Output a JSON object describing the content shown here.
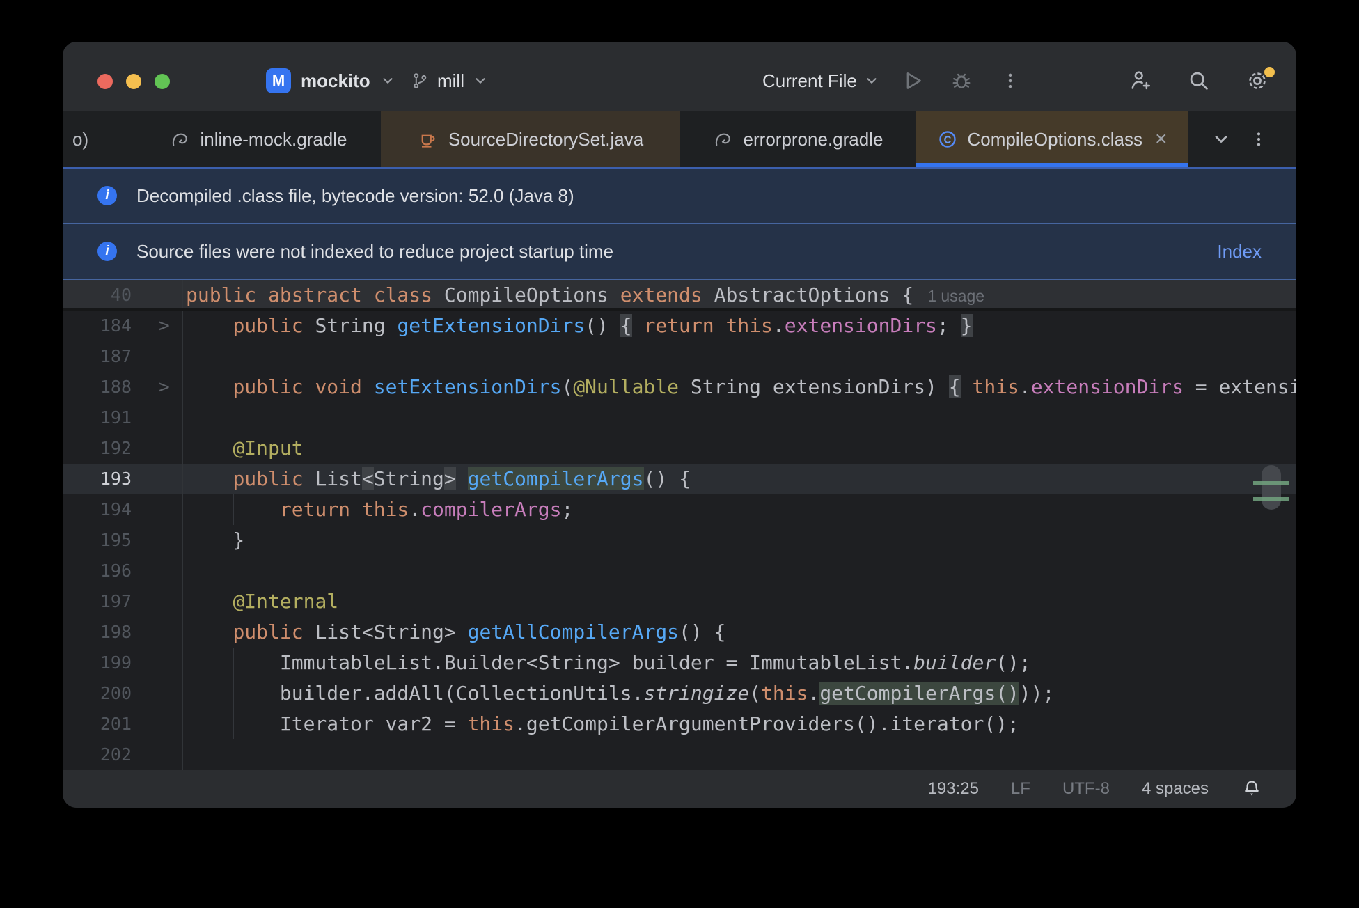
{
  "window": {
    "project": "mockito",
    "branch": "mill",
    "run_config": "Current File"
  },
  "tabs": {
    "items": [
      {
        "label": "o)"
      },
      {
        "label": "inline-mock.gradle",
        "icon": "gradle-icon"
      },
      {
        "label": "SourceDirectorySet.java",
        "icon": "java-icon"
      },
      {
        "label": "errorprone.gradle",
        "icon": "gradle-icon"
      },
      {
        "label": "CompileOptions.class",
        "icon": "class-icon",
        "active": true,
        "close": "×"
      }
    ]
  },
  "banners": [
    {
      "text": "Decompiled .class file, bytecode version: 52.0 (Java 8)"
    },
    {
      "text": "Source files were not indexed to reduce project startup time",
      "action": "Index"
    }
  ],
  "sticky": {
    "line_number": "40",
    "usage": "1 usage",
    "seg": [
      [
        "k",
        "public abstract class "
      ],
      [
        "p",
        "CompileOptions "
      ],
      [
        "k",
        "extends "
      ],
      [
        "p",
        "AbstractOptions {"
      ]
    ]
  },
  "editor": {
    "lines": [
      {
        "n": "184",
        "fold": true,
        "seg": [
          [
            "p",
            "    "
          ],
          [
            "k",
            "public"
          ],
          [
            "p",
            " String "
          ],
          [
            "m",
            "getExtensionDirs"
          ],
          [
            "p",
            "() "
          ],
          [
            "pb",
            "{"
          ],
          [
            "p",
            " "
          ],
          [
            "k",
            "return this"
          ],
          [
            "p",
            "."
          ],
          [
            "f",
            "extensionDirs"
          ],
          [
            "p",
            "; "
          ],
          [
            "pb",
            "}"
          ]
        ]
      },
      {
        "n": "187",
        "seg": []
      },
      {
        "n": "188",
        "fold": true,
        "seg": [
          [
            "p",
            "    "
          ],
          [
            "k",
            "public void "
          ],
          [
            "m",
            "setExtensionDirs"
          ],
          [
            "p",
            "("
          ],
          [
            "a",
            "@Nullable"
          ],
          [
            "p",
            " String extensionDirs) "
          ],
          [
            "pb",
            "{"
          ],
          [
            "p",
            " "
          ],
          [
            "k",
            "this"
          ],
          [
            "p",
            "."
          ],
          [
            "f",
            "extensionDirs"
          ],
          [
            "p",
            " = extensionDirs"
          ]
        ]
      },
      {
        "n": "191",
        "seg": []
      },
      {
        "n": "192",
        "seg": [
          [
            "p",
            "    "
          ],
          [
            "a",
            "@Input"
          ]
        ]
      },
      {
        "n": "193",
        "current": true,
        "seg": [
          [
            "p",
            "    "
          ],
          [
            "k",
            "public"
          ],
          [
            "p",
            " List"
          ],
          [
            "pb",
            "<"
          ],
          [
            "p",
            "String"
          ],
          [
            "pb",
            ">"
          ],
          [
            "p",
            " "
          ],
          [
            "mh",
            "getCompilerArgs"
          ],
          [
            "p",
            "() {"
          ]
        ]
      },
      {
        "n": "194",
        "guide": true,
        "seg": [
          [
            "p",
            "        "
          ],
          [
            "k",
            "return this"
          ],
          [
            "p",
            "."
          ],
          [
            "f",
            "compilerArgs"
          ],
          [
            "p",
            ";"
          ]
        ]
      },
      {
        "n": "195",
        "seg": [
          [
            "p",
            "    }"
          ]
        ]
      },
      {
        "n": "196",
        "seg": []
      },
      {
        "n": "197",
        "seg": [
          [
            "p",
            "    "
          ],
          [
            "a",
            "@Internal"
          ]
        ]
      },
      {
        "n": "198",
        "seg": [
          [
            "p",
            "    "
          ],
          [
            "k",
            "public"
          ],
          [
            "p",
            " List<String> "
          ],
          [
            "m",
            "getAllCompilerArgs"
          ],
          [
            "p",
            "() {"
          ]
        ]
      },
      {
        "n": "199",
        "guide": true,
        "seg": [
          [
            "p",
            "        ImmutableList.Builder<String> builder = ImmutableList."
          ],
          [
            "i",
            "builder"
          ],
          [
            "p",
            "();"
          ]
        ]
      },
      {
        "n": "200",
        "guide": true,
        "seg": [
          [
            "p",
            "        builder.addAll(CollectionUtils."
          ],
          [
            "i",
            "stringize"
          ],
          [
            "p",
            "("
          ],
          [
            "k",
            "this"
          ],
          [
            "p",
            "."
          ],
          [
            "ph",
            "getCompilerArgs()"
          ],
          [
            "p",
            "));"
          ]
        ]
      },
      {
        "n": "201",
        "guide": true,
        "seg": [
          [
            "p",
            "        Iterator var2 = "
          ],
          [
            "k",
            "this"
          ],
          [
            "p",
            ".getCompilerArgumentProviders().iterator();"
          ]
        ]
      },
      {
        "n": "202",
        "seg": []
      }
    ]
  },
  "status": {
    "caret": "193:25",
    "line_sep": "LF",
    "encoding": "UTF-8",
    "indent": "4 spaces"
  },
  "colors": {
    "accent": "#3574f0",
    "keyword": "#cf8e6d",
    "method": "#56a8f5",
    "field": "#c77dbb",
    "annotation": "#b3ae60",
    "tab_tint": "#453a29",
    "banner_bg": "#253248",
    "editor_bg": "#1e1f22",
    "notification_dot": "#f2bf4e"
  }
}
